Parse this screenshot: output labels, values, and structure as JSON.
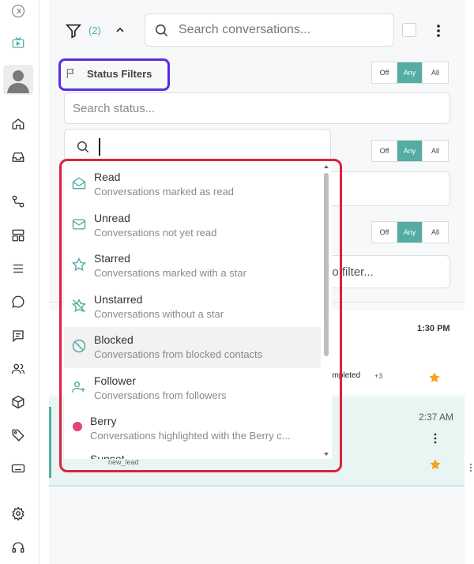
{
  "rail": {
    "icons": [
      "expand-icon",
      "channel-icon",
      "avatar",
      "home-icon",
      "inbox-icon",
      "workflow-icon",
      "layout-icon",
      "menu-icon",
      "chat-icon",
      "message-icon",
      "contacts-icon",
      "package-icon",
      "tag-icon",
      "keyboard-icon",
      "settings-icon",
      "headset-icon"
    ]
  },
  "header": {
    "filter_count": "(2)",
    "search_placeholder": "Search conversations..."
  },
  "status_filters": {
    "label": "Status Filters",
    "search_placeholder": "Search status...",
    "toggle_options": [
      "Off",
      "Any",
      "All"
    ],
    "active": "Any"
  },
  "background_filter": {
    "partial_placeholder": "lo filter..."
  },
  "dropdown": {
    "search_value": "",
    "options": [
      {
        "title": "Read",
        "desc": "Conversations marked as read",
        "icon": "envelope-open-icon"
      },
      {
        "title": "Unread",
        "desc": "Conversations not yet read",
        "icon": "envelope-icon"
      },
      {
        "title": "Starred",
        "desc": "Conversations marked with a star",
        "icon": "star-outline-icon"
      },
      {
        "title": "Unstarred",
        "desc": "Conversations without a star",
        "icon": "star-off-icon"
      },
      {
        "title": "Blocked",
        "desc": "Conversations from blocked contacts",
        "icon": "blocked-icon"
      },
      {
        "title": "Follower",
        "desc": "Conversations from followers",
        "icon": "user-plus-icon"
      },
      {
        "title": "Berry",
        "desc": "Conversations highlighted with the Berry c...",
        "icon": "berry-dot-icon"
      }
    ],
    "partial_next": "Sunset"
  },
  "conversations": [
    {
      "time": "1:30 PM",
      "tag_partial": "completed",
      "more": "+3"
    },
    {
      "time": "2:37 AM",
      "tag": "new_lead"
    }
  ],
  "colors": {
    "accent": "#55aca3",
    "highlight_red": "#e0203c",
    "highlight_purple": "#5b2be3",
    "star": "#f4a21c",
    "berry": "#e0457b"
  }
}
